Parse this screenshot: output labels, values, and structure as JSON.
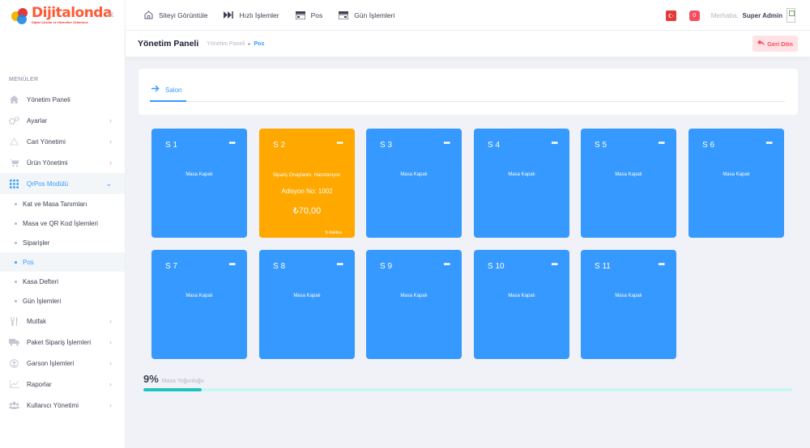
{
  "brand": {
    "name": "Dijitalonda",
    "tagline": "Dijital Çözüm ve Hizmetler Ortamınız"
  },
  "sidebar": {
    "menu_title": "MENÜLER",
    "items": [
      {
        "label": "Yönetim Paneli",
        "icon": "home-icon"
      },
      {
        "label": "Ayarlar",
        "icon": "gears-icon"
      },
      {
        "label": "Cari Yönetimi",
        "icon": "triangle-icon"
      },
      {
        "label": "Ürün Yönetimi",
        "icon": "cart-icon"
      },
      {
        "label": "QrPos Modülü",
        "icon": "grid-icon"
      },
      {
        "label": "Mutfak",
        "icon": "utensils-icon"
      },
      {
        "label": "Paket Sipariş İşlemleri",
        "icon": "truck-icon"
      },
      {
        "label": "Garson İşlemleri",
        "icon": "user-circle-icon"
      },
      {
        "label": "Raporlar",
        "icon": "chart-icon"
      },
      {
        "label": "Kullanıcı Yönetimi",
        "icon": "users-icon"
      }
    ],
    "submenu": [
      {
        "label": "Kat ve Masa Tanımları"
      },
      {
        "label": "Masa ve QR Kod İşlemleri"
      },
      {
        "label": "Siparişler"
      },
      {
        "label": "Pos"
      },
      {
        "label": "Kasa Defteri"
      },
      {
        "label": "Gün İşlemleri"
      }
    ]
  },
  "topbar": {
    "links": [
      {
        "label": "Siteyi Görüntüle",
        "icon": "home-icon"
      },
      {
        "label": "Hızlı İşlemler",
        "icon": "fast-forward-icon"
      },
      {
        "label": "Pos",
        "icon": "pos-icon"
      },
      {
        "label": "Gün İşlemleri",
        "icon": "register-icon"
      }
    ],
    "notification_count": "0",
    "greeting": "Merhaba,",
    "username": "Super Admin"
  },
  "subheader": {
    "title": "Yönetim Paneli",
    "breadcrumb": [
      "Yönetim Paneli",
      "Pos"
    ],
    "back_label": "Geri Dön"
  },
  "tabs": [
    {
      "label": "Salon"
    }
  ],
  "tables": [
    {
      "name": "S 1",
      "status": "Masa Kapalı",
      "occupied": false
    },
    {
      "name": "S 2",
      "occupied": true,
      "status": "Sipariş Onaylandı, Hazırlanıyor.",
      "order": "Adisyon No: 1002",
      "amount": "₺70,00",
      "elapsed": "9 dakika"
    },
    {
      "name": "S 3",
      "status": "Masa Kapalı",
      "occupied": false
    },
    {
      "name": "S 4",
      "status": "Masa Kapalı",
      "occupied": false
    },
    {
      "name": "S 5",
      "status": "Masa Kapalı",
      "occupied": false
    },
    {
      "name": "S 6",
      "status": "Masa Kapalı",
      "occupied": false
    },
    {
      "name": "S 7",
      "status": "Masa Kapalı",
      "occupied": false
    },
    {
      "name": "S 8",
      "status": "Masa Kapalı",
      "occupied": false
    },
    {
      "name": "S 9",
      "status": "Masa Kapalı",
      "occupied": false
    },
    {
      "name": "S 10",
      "status": "Masa Kapalı",
      "occupied": false
    },
    {
      "name": "S 11",
      "status": "Masa Kapalı",
      "occupied": false
    }
  ],
  "occupancy": {
    "percent_label": "9%",
    "label": "Masa Yoğunluğu",
    "value": 0.09
  },
  "colors": {
    "accent": "#3699ff",
    "occupied": "#ffa800",
    "danger": "#f64e60",
    "progress": "#1bc5bd"
  }
}
